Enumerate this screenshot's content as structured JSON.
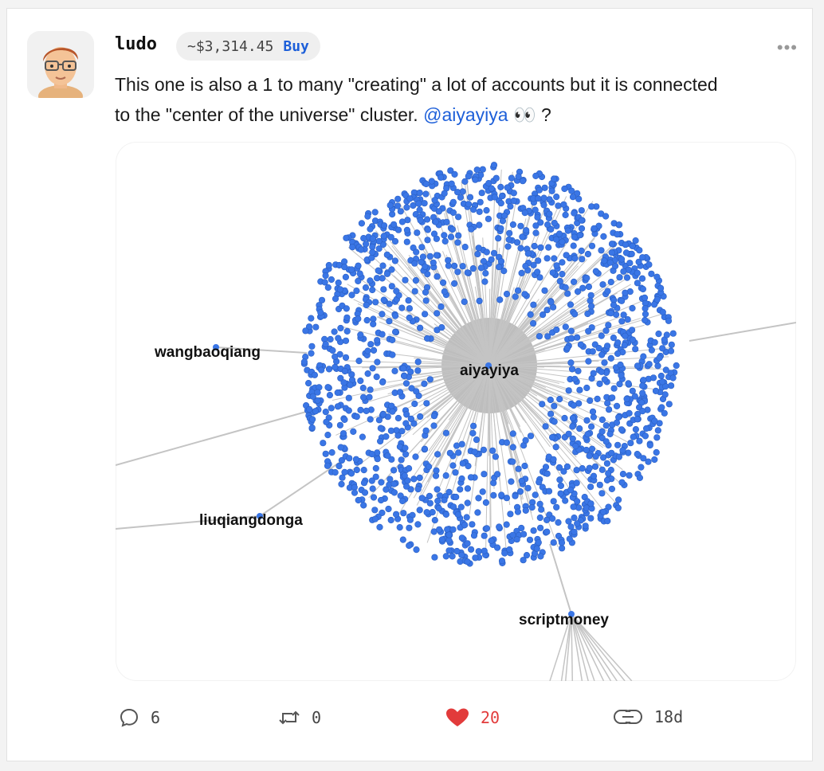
{
  "post": {
    "author": "ludo",
    "price": "~$3,314.45",
    "buy_label": "Buy",
    "more_label": "•••",
    "text_before": "This one is also a 1 to many \"creating\" a lot of accounts but it is connected to the \"center of the universe\" cluster. ",
    "mention": "@aiyayiya",
    "emoji": "👀",
    "text_after": " ?"
  },
  "graph": {
    "labels": {
      "center": "aiyayiya",
      "left_top": "wangbaoqiang",
      "left_bottom": "liuqiangdonga",
      "bottom": "scriptmoney"
    },
    "node_color": "#3a76e6",
    "edge_color": "#c4c4c4"
  },
  "actions": {
    "comments": "6",
    "reposts": "0",
    "likes": "20",
    "age": "18d"
  },
  "colors": {
    "accent": "#1d5fd9",
    "like": "#e23b3b"
  }
}
